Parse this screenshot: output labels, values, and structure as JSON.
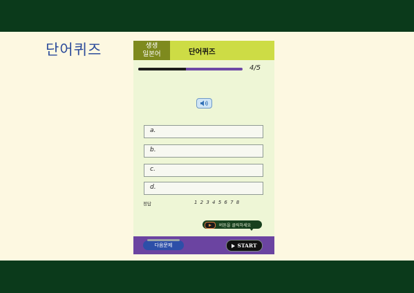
{
  "page_heading": "단어퀴즈",
  "panel": {
    "badge_line1": "생생",
    "badge_line2": "일본어",
    "title": "단어퀴즈"
  },
  "progress": {
    "counter": "4/5",
    "fraction": 0.46
  },
  "speaker_icon": "speaker-icon",
  "options": [
    {
      "letter": "a."
    },
    {
      "letter": "b."
    },
    {
      "letter": "c."
    },
    {
      "letter": "d."
    }
  ],
  "answer_label": "정답",
  "answer_numbers": "1 2 3 4 5 6 7 8",
  "hint_button": {
    "label": "버튼을 클릭하세요"
  },
  "footer": {
    "next_label": "다음문제",
    "start_label": "START"
  },
  "colors": {
    "band": "#0b3a1b",
    "background": "#fdf8e1",
    "panel": "#eef6d6",
    "header": "#cddc45",
    "badge": "#7e8a1e",
    "progress_track": "#6e4aa6",
    "footer": "#6b44a1"
  }
}
